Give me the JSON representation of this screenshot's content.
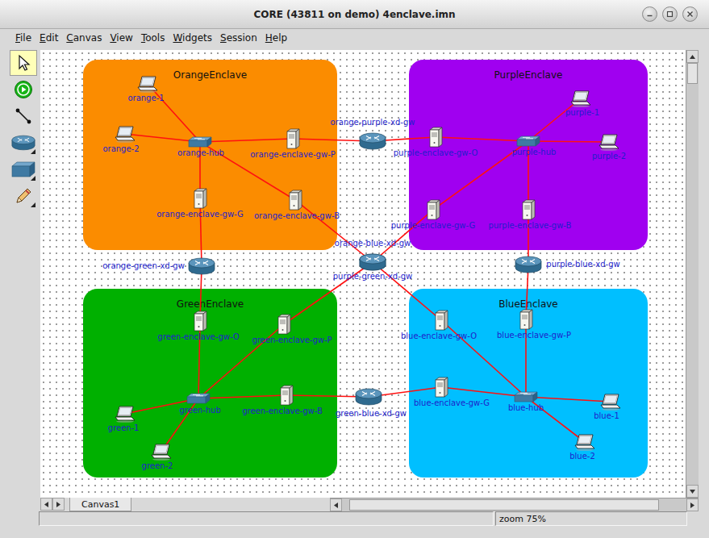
{
  "window": {
    "title": "CORE (43811 on demo) 4enclave.imn"
  },
  "menu": [
    "File",
    "Edit",
    "Canvas",
    "View",
    "Tools",
    "Widgets",
    "Session",
    "Help"
  ],
  "toolbar": [
    {
      "kind": "select",
      "selected": true
    },
    {
      "kind": "start",
      "selected": false
    },
    {
      "kind": "link",
      "selected": false
    },
    {
      "kind": "router",
      "selected": false
    },
    {
      "kind": "switch",
      "selected": false
    },
    {
      "kind": "annotate",
      "selected": false
    }
  ],
  "enclaves": [
    {
      "label": "OrangeEnclave",
      "color": "#fb8c00"
    },
    {
      "label": "PurpleEnclave",
      "color": "#a000f0"
    },
    {
      "label": "GreenEnclave",
      "color": "#00b000"
    },
    {
      "label": "BlueEnclave",
      "color": "#00bfff"
    }
  ],
  "nodes": [
    {
      "label": "orange-1",
      "kind": "laptop"
    },
    {
      "label": "orange-2",
      "kind": "laptop"
    },
    {
      "label": "orange-hub",
      "kind": "switch"
    },
    {
      "label": "orange-enclave-gw-P",
      "kind": "server"
    },
    {
      "label": "orange-enclave-gw-G",
      "kind": "server"
    },
    {
      "label": "orange-enclave-gw-B",
      "kind": "server"
    },
    {
      "label": "purple-1",
      "kind": "laptop"
    },
    {
      "label": "purple-2",
      "kind": "laptop"
    },
    {
      "label": "purple-hub",
      "kind": "switch"
    },
    {
      "label": "purple-enclave-gw-O",
      "kind": "server"
    },
    {
      "label": "purple-enclave-gw-G",
      "kind": "server"
    },
    {
      "label": "purple-enclave-gw-B",
      "kind": "server"
    },
    {
      "label": "green-1",
      "kind": "laptop"
    },
    {
      "label": "green-2",
      "kind": "laptop"
    },
    {
      "label": "green-hub",
      "kind": "switch"
    },
    {
      "label": "green-enclave-gw-O",
      "kind": "server"
    },
    {
      "label": "green-enclave-gw-P",
      "kind": "server"
    },
    {
      "label": "green-enclave-gw-B",
      "kind": "server"
    },
    {
      "label": "blue-1",
      "kind": "laptop"
    },
    {
      "label": "blue-2",
      "kind": "laptop"
    },
    {
      "label": "blue-hub",
      "kind": "switch"
    },
    {
      "label": "blue-enclave-gw-O",
      "kind": "server"
    },
    {
      "label": "blue-enclave-gw-P",
      "kind": "server"
    },
    {
      "label": "blue-enclave-gw-G",
      "kind": "server"
    },
    {
      "label": "orange-purple-xd-gw",
      "kind": "router"
    },
    {
      "label": "orange-green-xd-gw",
      "kind": "router"
    },
    {
      "label": "orange-blue-xd-gw",
      "kind": "router"
    },
    {
      "label": "purple-green-xd-gw",
      "kind": "router"
    },
    {
      "label": "purple-blue-xd-gw",
      "kind": "router"
    },
    {
      "label": "green-blue-xd-gw",
      "kind": "router"
    }
  ],
  "links": [
    [
      "orange-1",
      "orange-hub"
    ],
    [
      "orange-2",
      "orange-hub"
    ],
    [
      "orange-hub",
      "orange-enclave-gw-P"
    ],
    [
      "orange-hub",
      "orange-enclave-gw-G"
    ],
    [
      "orange-hub",
      "orange-enclave-gw-B"
    ],
    [
      "orange-enclave-gw-P",
      "orange-purple-xd-gw"
    ],
    [
      "orange-purple-xd-gw",
      "purple-enclave-gw-O"
    ],
    [
      "purple-enclave-gw-O",
      "purple-hub"
    ],
    [
      "purple-hub",
      "purple-1"
    ],
    [
      "purple-hub",
      "purple-2"
    ],
    [
      "purple-hub",
      "purple-enclave-gw-G"
    ],
    [
      "purple-hub",
      "purple-enclave-gw-B"
    ],
    [
      "orange-enclave-gw-G",
      "orange-green-xd-gw"
    ],
    [
      "orange-green-xd-gw",
      "green-enclave-gw-O"
    ],
    [
      "green-enclave-gw-O",
      "green-hub"
    ],
    [
      "orange-enclave-gw-B",
      "orange-blue-xd-gw"
    ],
    [
      "orange-blue-xd-gw",
      "blue-enclave-gw-O"
    ],
    [
      "blue-enclave-gw-O",
      "blue-hub"
    ],
    [
      "purple-enclave-gw-G",
      "purple-green-xd-gw"
    ],
    [
      "purple-green-xd-gw",
      "green-enclave-gw-P"
    ],
    [
      "green-enclave-gw-P",
      "green-hub"
    ],
    [
      "purple-enclave-gw-B",
      "purple-blue-xd-gw"
    ],
    [
      "purple-blue-xd-gw",
      "blue-enclave-gw-P"
    ],
    [
      "blue-enclave-gw-P",
      "blue-hub"
    ],
    [
      "green-hub",
      "green-enclave-gw-B"
    ],
    [
      "green-enclave-gw-B",
      "green-blue-xd-gw"
    ],
    [
      "green-blue-xd-gw",
      "blue-enclave-gw-G"
    ],
    [
      "blue-enclave-gw-G",
      "blue-hub"
    ],
    [
      "green-hub",
      "green-1"
    ],
    [
      "green-hub",
      "green-2"
    ],
    [
      "blue-hub",
      "blue-1"
    ],
    [
      "blue-hub",
      "blue-2"
    ]
  ],
  "canvas_tabs": [
    {
      "label": "Canvas1",
      "selected": true
    }
  ],
  "scrollbars": {
    "vertical": {
      "start": 0.0,
      "size": 0.05
    },
    "horizontal": {
      "start": 0.02,
      "size": 0.9
    }
  },
  "status_bar": {
    "zoom": "zoom 75%"
  }
}
